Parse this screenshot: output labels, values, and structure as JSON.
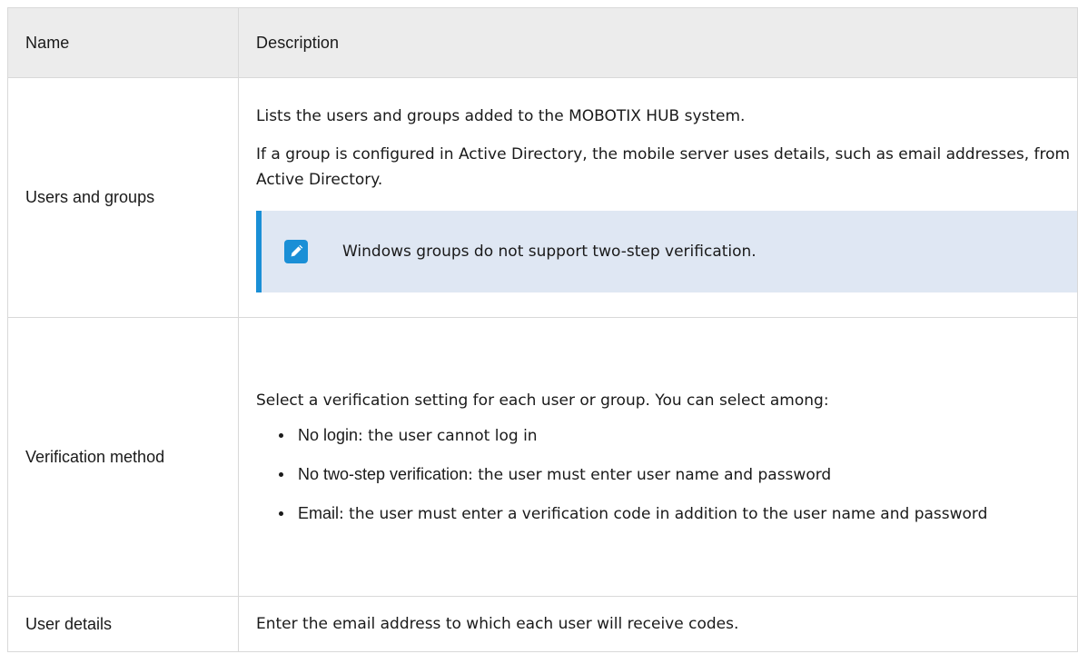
{
  "table": {
    "headers": {
      "name": "Name",
      "description": "Description"
    },
    "rows": [
      {
        "name": "Users and groups",
        "paragraphs": [
          "Lists the users and groups added to the MOBOTIX HUB system.",
          "If a group is configured in Active Directory, the mobile server uses details, such as email addresses, from Active Directory."
        ],
        "note": {
          "icon": "pencil-icon",
          "text": "Windows groups do not support two-step verification."
        }
      },
      {
        "name": "Verification method",
        "intro": "Select a verification setting for each user or group. You can select among:",
        "options": [
          {
            "term": "No login",
            "detail": ": the user cannot log in"
          },
          {
            "term": "No two-step verification",
            "detail": ": the user must enter user name and password"
          },
          {
            "term": "Email",
            "detail": ": the user must enter a verification code in addition to the user name and password"
          }
        ]
      },
      {
        "name": "User details",
        "text": "Enter the email address to which each user will receive codes."
      }
    ]
  },
  "colors": {
    "header_bg": "#ececec",
    "border": "#d9d9d9",
    "note_bg": "#dfe7f3",
    "accent": "#1a8fd6"
  }
}
